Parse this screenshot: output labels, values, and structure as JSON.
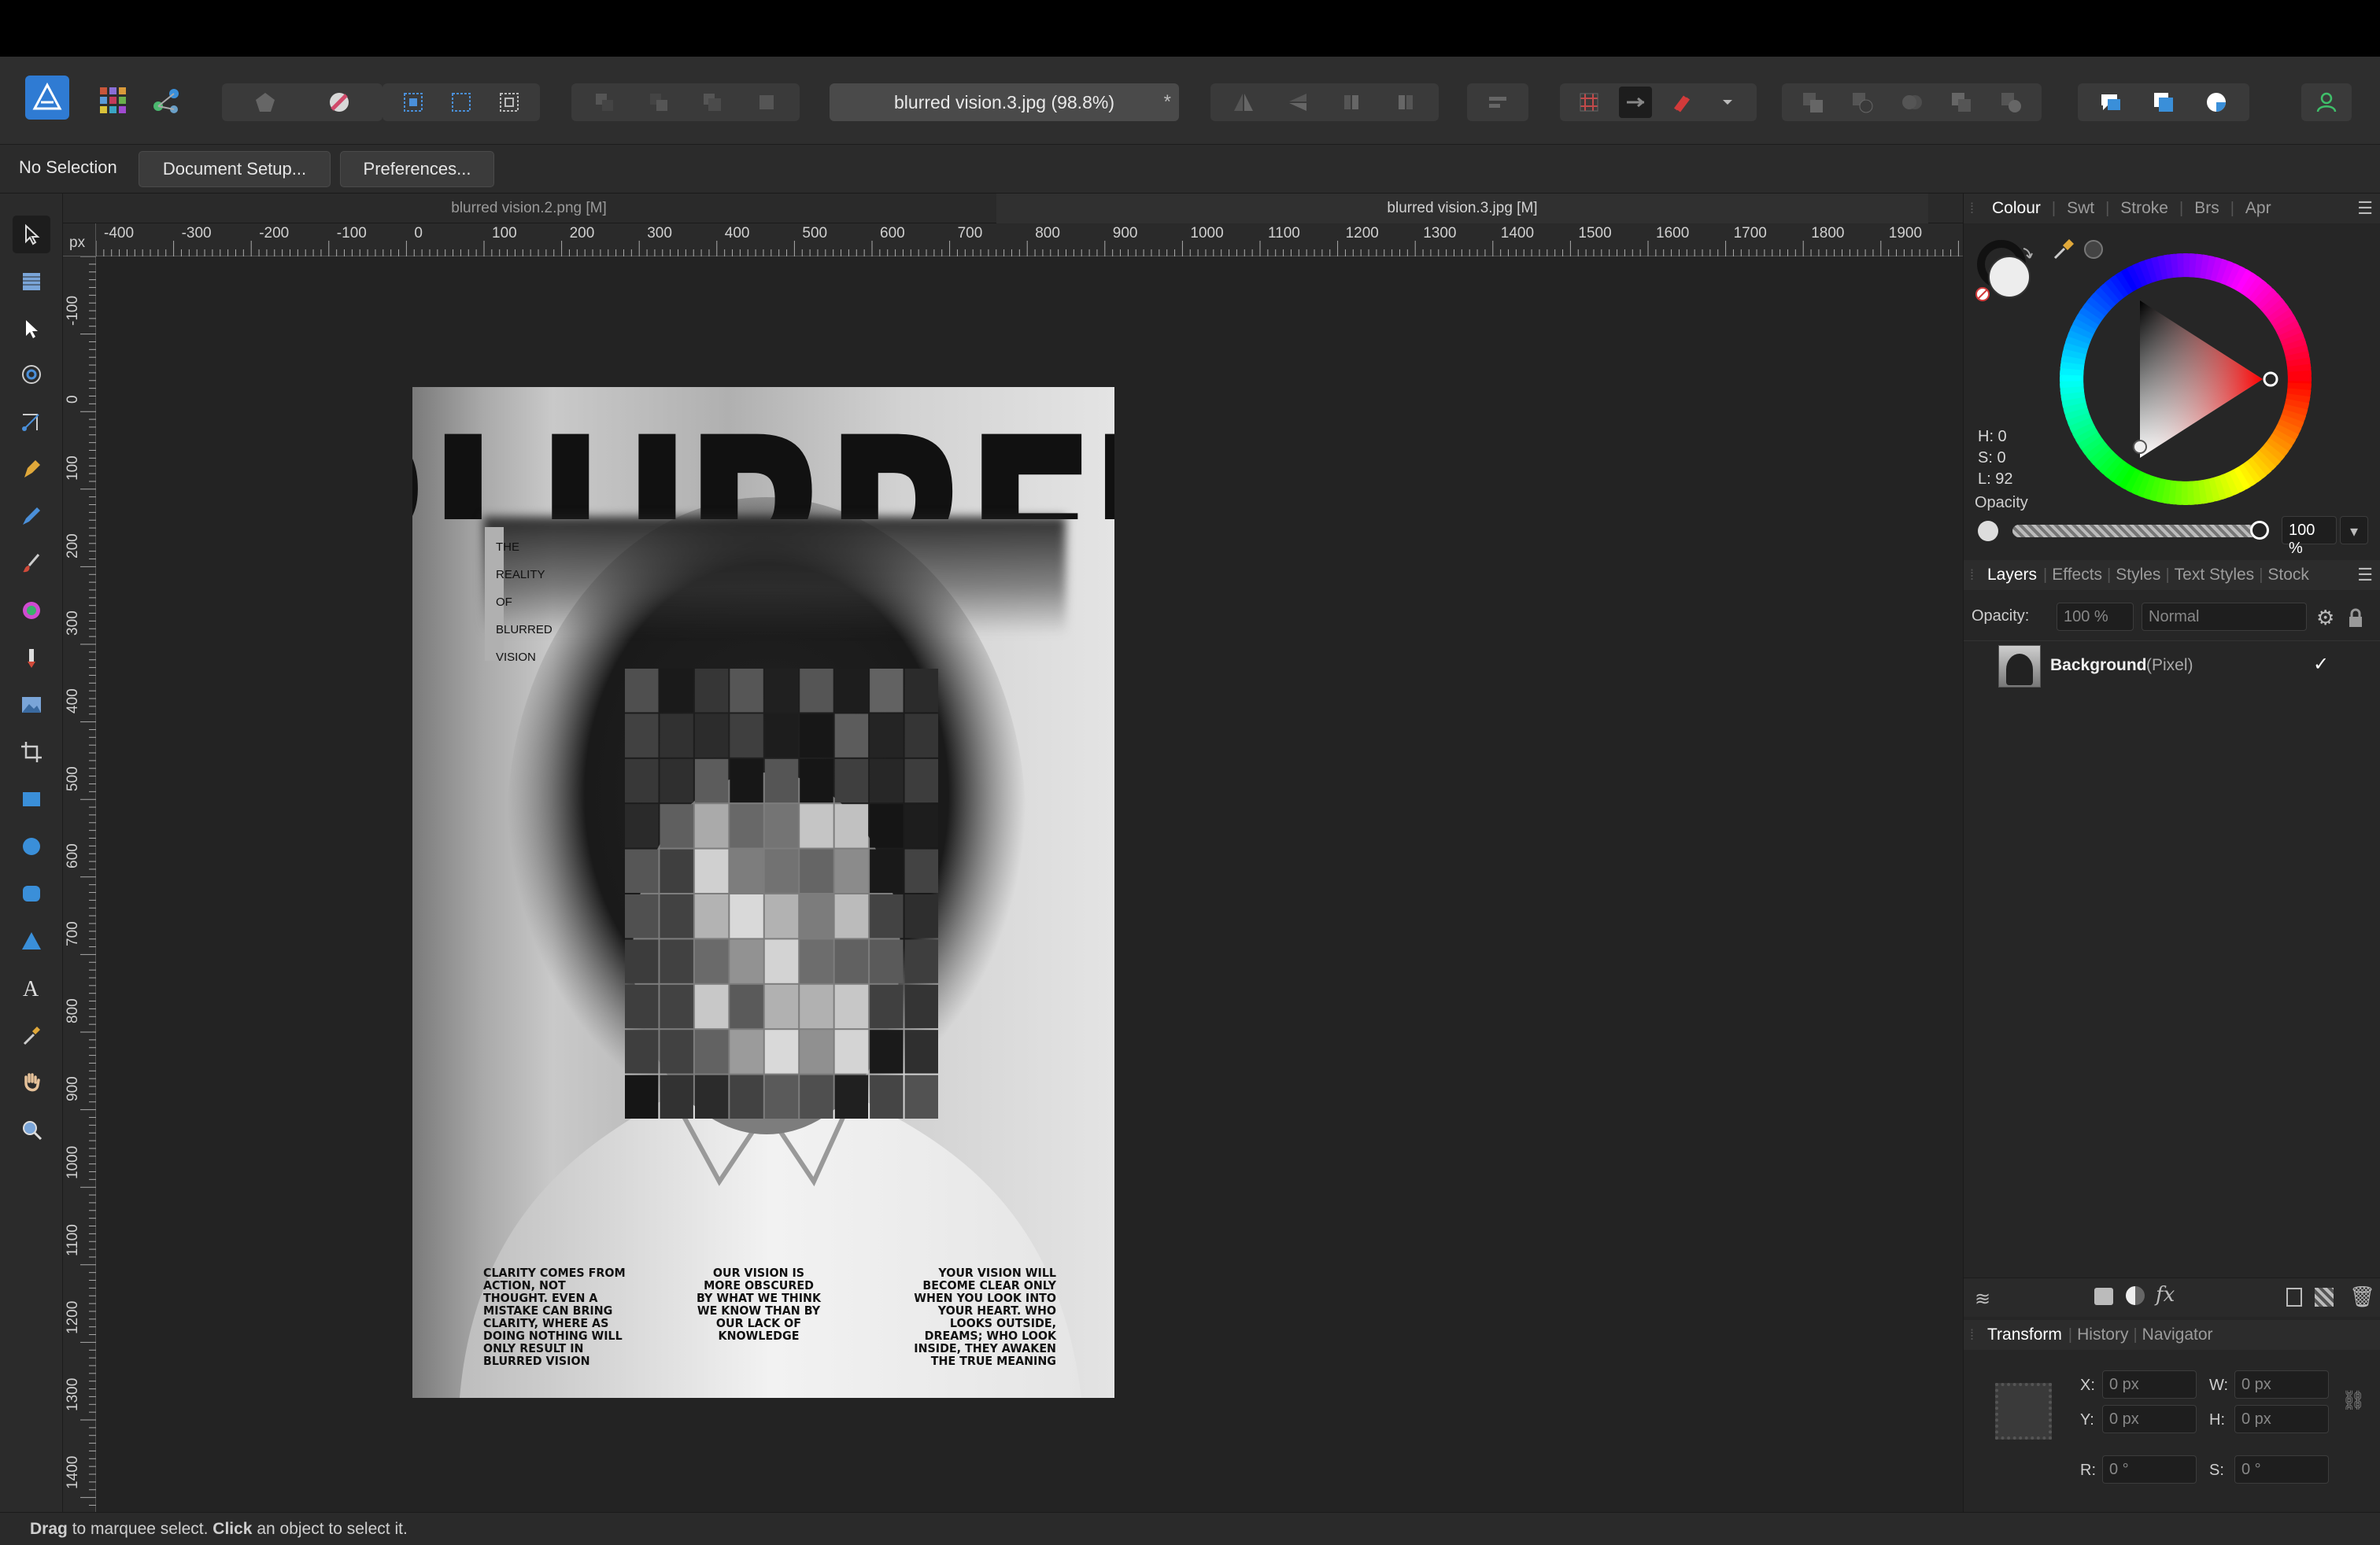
{
  "window": {
    "background": "#000000"
  },
  "toolbar": {
    "document_title": "blurred vision.3.jpg (98.8%)",
    "document_modified_mark": "*"
  },
  "context": {
    "selection_label": "No Selection",
    "document_setup_label": "Document Setup...",
    "preferences_label": "Preferences..."
  },
  "doc_tabs": [
    {
      "label": "blurred vision.2.png [M]"
    },
    {
      "label": "blurred vision.3.jpg [M]"
    }
  ],
  "rulers": {
    "unit": "px",
    "horizontal": [
      "-400",
      "-300",
      "-200",
      "-100",
      "0",
      "100",
      "200",
      "300",
      "400",
      "500",
      "600",
      "700",
      "800",
      "900",
      "1000",
      "1100",
      "1200",
      "1300",
      "1400",
      "1500",
      "1600",
      "1700",
      "1800",
      "1900"
    ],
    "vertical": [
      "-100",
      "0",
      "100",
      "200",
      "300",
      "400",
      "500",
      "600",
      "700",
      "800",
      "900",
      "1000",
      "1100",
      "1200",
      "1300",
      "1400"
    ]
  },
  "poster": {
    "headline": "BLURRED",
    "side_text": [
      "THE",
      "REALITY",
      "OF",
      "BLURRED",
      "VISION"
    ],
    "columns": [
      "CLARITY COMES FROM ACTION, NOT THOUGHT. EVEN A MISTAKE CAN BRING CLARITY, WHERE AS DOING NOTHING WILL ONLY RESULT IN BLURRED VISION",
      "OUR VISION IS MORE OBSCURED BY WHAT WE THINK WE KNOW THAN BY OUR LACK OF KNOWLEDGE",
      "YOUR VISION WILL BECOME CLEAR ONLY WHEN YOU LOOK INTO YOUR HEART. WHO LOOKS OUTSIDE, DREAMS; WHO LOOK INSIDE, THEY AWAKEN THE TRUE MEANING"
    ]
  },
  "colour_panel": {
    "tabs": [
      "Colour",
      "Swt",
      "Stroke",
      "Brs",
      "Apr"
    ],
    "active_tab": "Colour",
    "hsl": {
      "h": "H: 0",
      "s": "S: 0",
      "l": "L: 92"
    },
    "opacity_label": "Opacity",
    "opacity_value": "100 %",
    "hue_marker_color": "#ff0000"
  },
  "layers_panel": {
    "tabs": [
      "Layers",
      "Effects",
      "Styles",
      "Text Styles",
      "Stock"
    ],
    "active_tab": "Layers",
    "opacity_label": "Opacity:",
    "opacity_value": "100 %",
    "blend_mode": "Normal",
    "layers": [
      {
        "name": "Background",
        "type": "(Pixel)",
        "visible": "✓"
      }
    ]
  },
  "transform_panel": {
    "tabs": [
      "Transform",
      "History",
      "Navigator"
    ],
    "active_tab": "Transform",
    "x_label": "X:",
    "x_value": "0 px",
    "y_label": "Y:",
    "y_value": "0 px",
    "w_label": "W:",
    "w_value": "0 px",
    "h_label": "H:",
    "h_value": "0 px",
    "r_label": "R:",
    "r_value": "0 °",
    "s_label": "S:",
    "s_value": "0 °"
  },
  "status": {
    "drag_word": "Drag",
    "drag_rest": " to marquee select. ",
    "click_word": "Click",
    "click_rest": " an object to select it."
  },
  "accent": "#4a90d9"
}
